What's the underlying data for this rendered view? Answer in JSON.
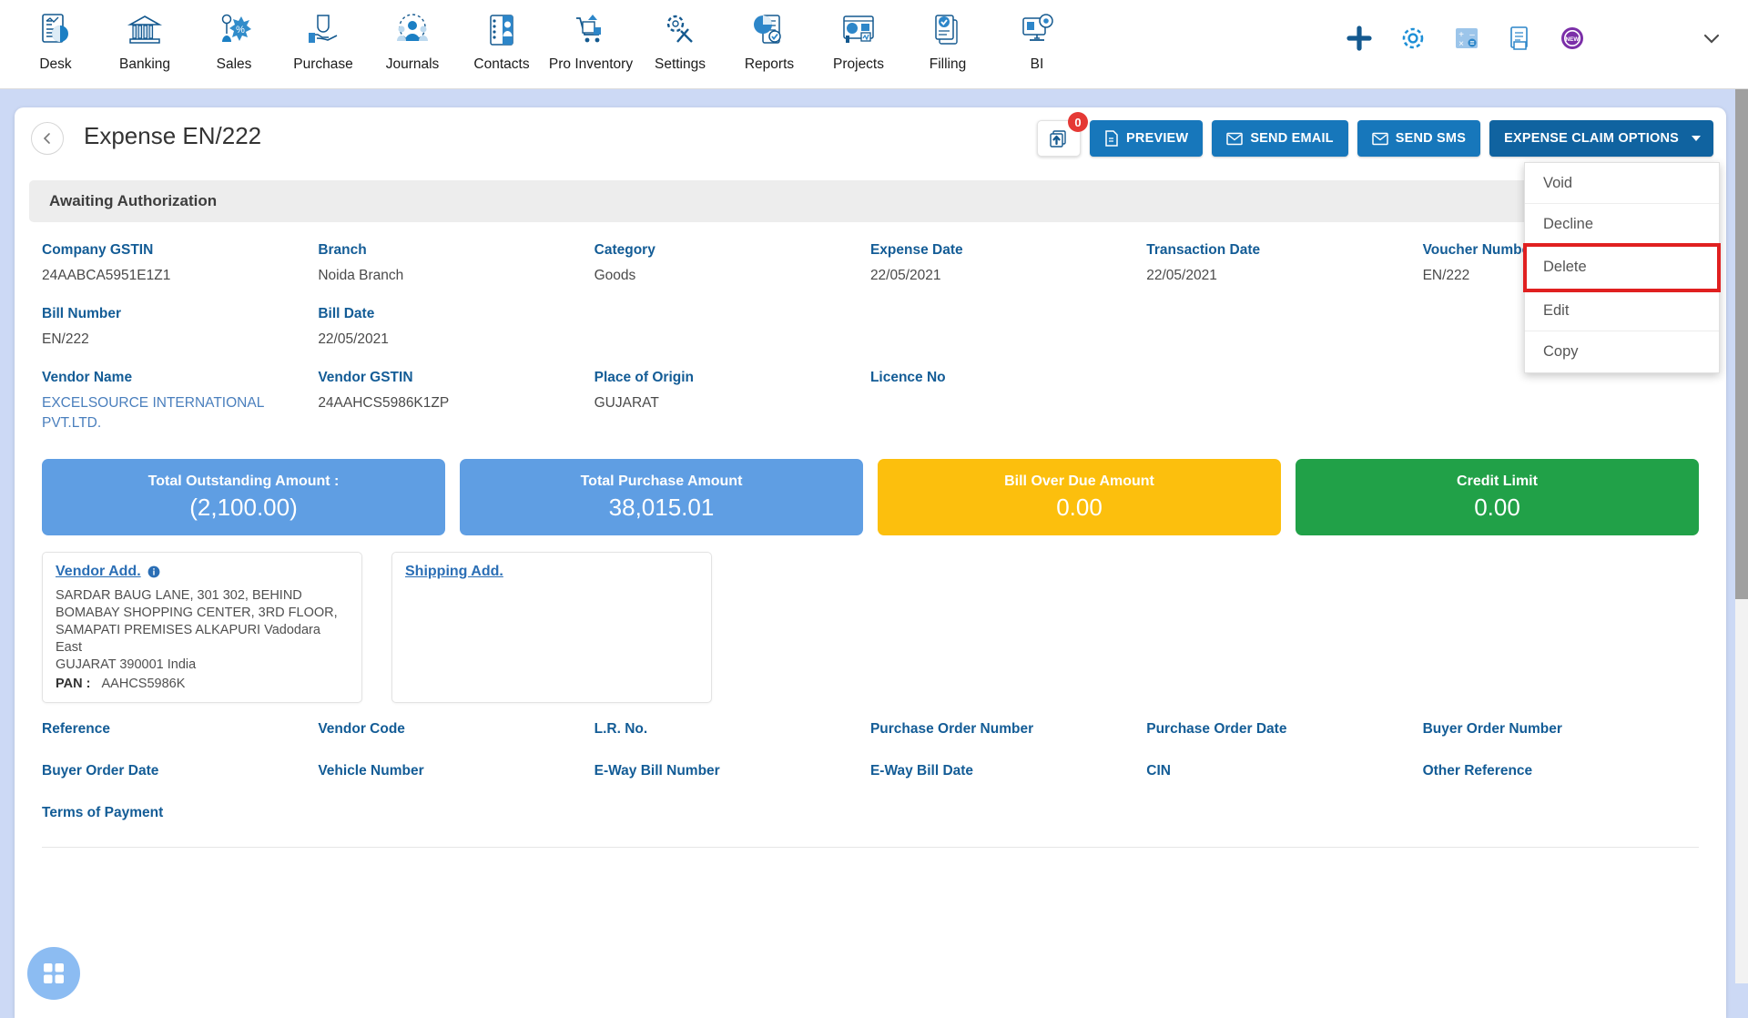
{
  "topnav": {
    "items": [
      {
        "label": "Desk",
        "icon": "desk-dashboard-icon"
      },
      {
        "label": "Banking",
        "icon": "bank-icon"
      },
      {
        "label": "Sales",
        "icon": "sales-tag-icon"
      },
      {
        "label": "Purchase",
        "icon": "purchase-hand-icon"
      },
      {
        "label": "Journals",
        "icon": "journals-people-icon"
      },
      {
        "label": "Contacts",
        "icon": "contacts-card-icon"
      },
      {
        "label": "Pro Inventory",
        "icon": "inventory-cart-icon"
      },
      {
        "label": "Settings",
        "icon": "settings-tools-icon"
      },
      {
        "label": "Reports",
        "icon": "reports-chart-icon"
      },
      {
        "label": "Projects",
        "icon": "projects-board-icon"
      },
      {
        "label": "Filling",
        "icon": "filling-documents-icon"
      },
      {
        "label": "BI",
        "icon": "bi-monitor-icon"
      }
    ],
    "right_icons": [
      {
        "name": "plus-icon"
      },
      {
        "name": "gear-icon"
      },
      {
        "name": "calculator-icon"
      },
      {
        "name": "notes-icon"
      },
      {
        "name": "new-badge-icon"
      },
      {
        "name": "chevron-down-icon"
      }
    ]
  },
  "header": {
    "back_icon": "chevron-left-icon",
    "title": "Expense EN/222",
    "upload_icon": "upload-folder-icon",
    "upload_badge": "0",
    "buttons": [
      {
        "label": "PREVIEW",
        "icon": "pdf-file-icon",
        "style": "primary"
      },
      {
        "label": "SEND EMAIL",
        "icon": "envelope-icon",
        "style": "primary"
      },
      {
        "label": "SEND SMS",
        "icon": "envelope-icon",
        "style": "primary"
      },
      {
        "label": "EXPENSE CLAIM OPTIONS",
        "icon": "caret-down-icon",
        "style": "dark"
      }
    ]
  },
  "dropdown": {
    "open": true,
    "highlight_color": "#e02020",
    "items": [
      {
        "label": "Void",
        "highlighted": false
      },
      {
        "label": "Decline",
        "highlighted": false
      },
      {
        "label": "Delete",
        "highlighted": true
      },
      {
        "label": "Edit",
        "highlighted": false
      },
      {
        "label": "Copy",
        "highlighted": false
      }
    ]
  },
  "status": {
    "text": "Awaiting Authorization"
  },
  "details": {
    "row1": [
      {
        "label": "Company GSTIN",
        "value": "24AABCA5951E1Z1"
      },
      {
        "label": "Branch",
        "value": "Noida Branch"
      },
      {
        "label": "Category",
        "value": "Goods"
      },
      {
        "label": "Expense Date",
        "value": "22/05/2021"
      },
      {
        "label": "Transaction Date",
        "value": "22/05/2021"
      },
      {
        "label": "Voucher Number",
        "value": "EN/222"
      }
    ],
    "row2": [
      {
        "label": "Bill Number",
        "value": "EN/222"
      },
      {
        "label": "Bill Date",
        "value": "22/05/2021"
      },
      {
        "label": "",
        "value": ""
      },
      {
        "label": "",
        "value": ""
      },
      {
        "label": "",
        "value": ""
      },
      {
        "label": "",
        "value": ""
      }
    ],
    "row3": [
      {
        "label": "Vendor Name",
        "value": "EXCELSOURCE INTERNATIONAL PVT.LTD.",
        "link": true
      },
      {
        "label": "Vendor GSTIN",
        "value": "24AAHCS5986K1ZP"
      },
      {
        "label": "Place of Origin",
        "value": "GUJARAT"
      },
      {
        "label": "Licence No",
        "value": ""
      },
      {
        "label": "",
        "value": ""
      },
      {
        "label": "",
        "value": ""
      }
    ]
  },
  "amount_cards": [
    {
      "title": "Total Outstanding Amount :",
      "value": "(2,100.00)",
      "color": "#5f9ee3"
    },
    {
      "title": "Total Purchase Amount",
      "value": "38,015.01",
      "color": "#5f9ee3"
    },
    {
      "title": "Bill Over Due Amount",
      "value": "0.00",
      "color": "#fcbf0d"
    },
    {
      "title": "Credit Limit",
      "value": "0.00",
      "color": "#21a148"
    }
  ],
  "addresses": {
    "vendor": {
      "title": "Vendor Add.",
      "info_icon": "info-icon",
      "lines": [
        "SARDAR BAUG LANE, 301 302, BEHIND",
        "BOMABAY SHOPPING CENTER, 3RD FLOOR,",
        "SAMAPATI PREMISES ALKAPURI Vadodara East",
        "GUJARAT 390001 India"
      ],
      "pan_label": "PAN :",
      "pan_value": "AAHCS5986K"
    },
    "shipping": {
      "title": "Shipping Add.",
      "lines": []
    }
  },
  "bottom_fields": {
    "row1": [
      "Reference",
      "Vendor Code",
      "L.R. No.",
      "Purchase Order Number",
      "Purchase Order Date",
      "Buyer Order Number"
    ],
    "row2": [
      "Buyer Order Date",
      "Vehicle Number",
      "E-Way Bill Number",
      "E-Way Bill Date",
      "CIN",
      "Other Reference"
    ],
    "row3": [
      "Terms of Payment"
    ]
  },
  "fab": {
    "icon": "grid-apps-icon"
  }
}
